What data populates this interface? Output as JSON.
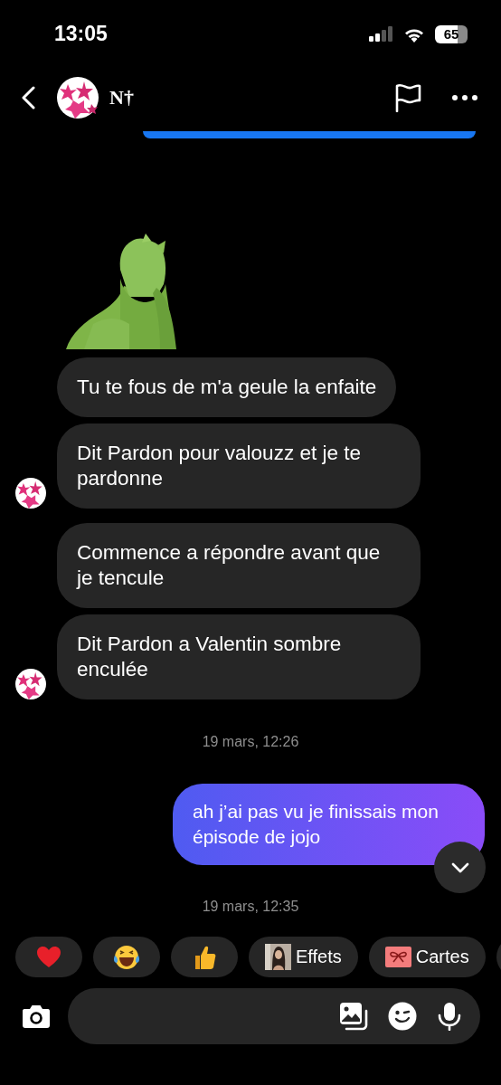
{
  "status_bar": {
    "time": "13:05",
    "battery": "65"
  },
  "header": {
    "name": "N†"
  },
  "messages": [
    {
      "kind": "bubble_edge"
    },
    {
      "kind": "sticker"
    },
    {
      "kind": "received",
      "text": "Tu te fous de m'a geule la enfaite",
      "show_avatar": false
    },
    {
      "kind": "received",
      "text": "Dit Pardon pour valouzz et je te pardonne",
      "show_avatar": true
    },
    {
      "kind": "received",
      "text": "Commence a répondre avant que je tencule",
      "show_avatar": false
    },
    {
      "kind": "received",
      "text": "Dit Pardon a Valentin sombre enculée",
      "show_avatar": true
    },
    {
      "kind": "timestamp",
      "text": "19 mars, 12:26"
    },
    {
      "kind": "sent",
      "text": "ah j’ai pas vu je finissais mon épisode de jojo"
    },
    {
      "kind": "timestamp",
      "text": "19 mars, 12:35"
    }
  ],
  "quick_reactions": [
    {
      "kind": "heart"
    },
    {
      "kind": "laugh"
    },
    {
      "kind": "thumbs_up"
    },
    {
      "kind": "effects",
      "label": "Effets"
    },
    {
      "kind": "cards",
      "label": "Cartes"
    },
    {
      "kind": "more"
    }
  ]
}
